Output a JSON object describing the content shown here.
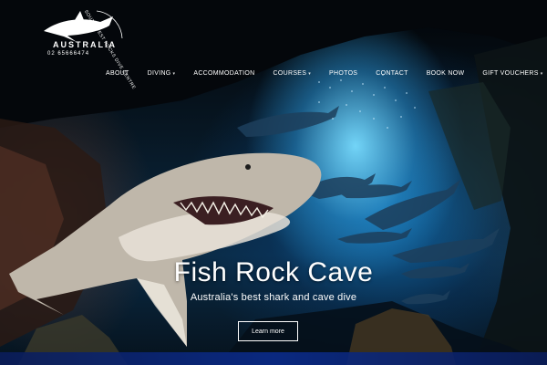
{
  "logo": {
    "ring_text": "SOUTH WEST ROCKS DIVE CENTRE",
    "country": "AUSTRALIA",
    "phone": "02 65666474",
    "icon": "shark-icon"
  },
  "nav": {
    "items": [
      {
        "label": "ABOUT",
        "has_dropdown": false
      },
      {
        "label": "DIVING",
        "has_dropdown": true
      },
      {
        "label": "ACCOMMODATION",
        "has_dropdown": false
      },
      {
        "label": "COURSES",
        "has_dropdown": true
      },
      {
        "label": "PHOTOS",
        "has_dropdown": false
      },
      {
        "label": "CONTACT",
        "has_dropdown": false
      },
      {
        "label": "BOOK NOW",
        "has_dropdown": false
      },
      {
        "label": "GIFT VOUCHERS",
        "has_dropdown": true
      }
    ],
    "caret": "▾"
  },
  "hero": {
    "title": "Fish Rock Cave",
    "subtitle": "Australia's best shark and cave dive",
    "button_label": "Learn more"
  }
}
